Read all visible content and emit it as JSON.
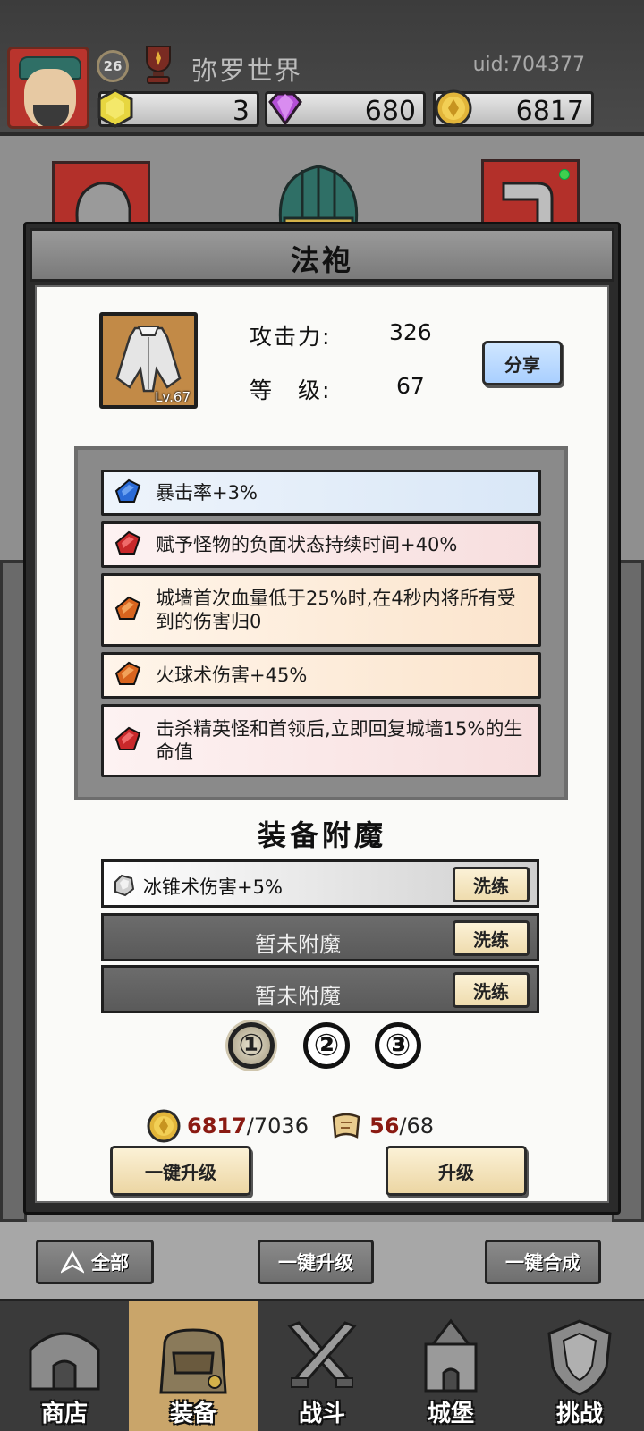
{
  "player": {
    "level": "26",
    "name": "弥罗世界",
    "uid": "uid:704377"
  },
  "resources": {
    "energy": "3",
    "gems": "680",
    "gold": "6817"
  },
  "item": {
    "title": "法袍",
    "level_tag": "Lv.67",
    "attack_label": "攻击力:",
    "attack_value": "326",
    "level_label": "等　级:",
    "level_value": "67",
    "share_label": "分享"
  },
  "affixes": [
    {
      "text": "暴击率+3%",
      "gem": "blue-gem-icon"
    },
    {
      "text": "赋予怪物的负面状态持续时间+40%",
      "gem": "red-gem-icon"
    },
    {
      "text": "城墙首次血量低于25%时,在4秒内将所有受到的伤害归0",
      "gem": "orange-gem-icon"
    },
    {
      "text": "火球术伤害+45%",
      "gem": "orange-gem-icon"
    },
    {
      "text": "击杀精英怪和首领后,立即回复城墙15%的生命值",
      "gem": "red-gem-icon"
    }
  ],
  "enchant": {
    "title": "装备附魔",
    "slots": [
      {
        "text": "冰锥术伤害+5%",
        "button": "洗练"
      },
      {
        "text": "暂未附魔",
        "button": "洗练"
      },
      {
        "text": "暂未附魔",
        "button": "洗练"
      }
    ],
    "pages": [
      "①",
      "②",
      "③"
    ],
    "active_page": 1
  },
  "costs": {
    "gold_have": "6817",
    "gold_need": "/7036",
    "scroll_have": "56",
    "scroll_need": "/68"
  },
  "actions": {
    "upgrade_all": "一键升级",
    "upgrade": "升级"
  },
  "filters": {
    "all": "全部",
    "upgrade_all": "一键升级",
    "merge_all": "一键合成"
  },
  "nav": [
    {
      "label": "商店"
    },
    {
      "label": "装备"
    },
    {
      "label": "战斗"
    },
    {
      "label": "城堡"
    },
    {
      "label": "挑战"
    }
  ],
  "colors": {
    "accent_red": "#b3302a",
    "active_tab": "#c9a56a",
    "have_amount": "#8a1a12"
  }
}
